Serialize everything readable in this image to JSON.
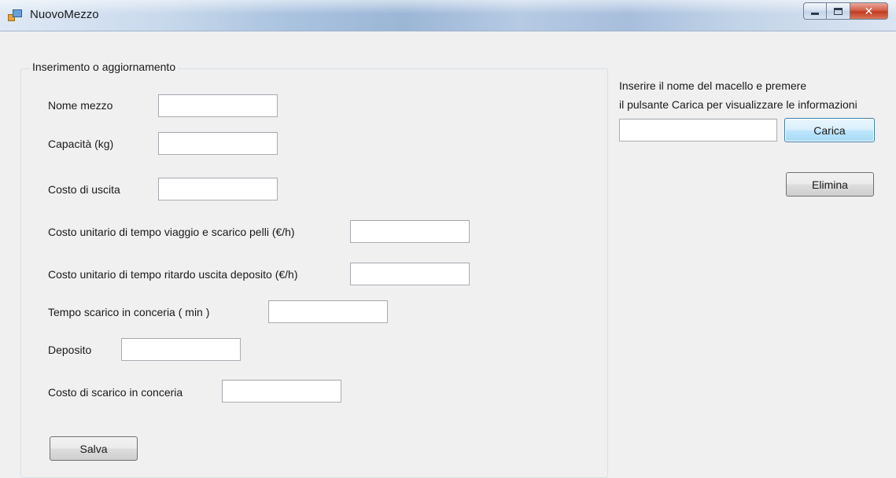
{
  "window": {
    "title": "NuovoMezzo"
  },
  "form": {
    "group_title": "Inserimento o aggiornamento",
    "fields": [
      {
        "label": "Nome mezzo",
        "value": ""
      },
      {
        "label": "Capacità (kg)",
        "value": ""
      },
      {
        "label": "Costo di uscita",
        "value": ""
      },
      {
        "label": "Costo unitario di tempo viaggio e scarico pelli (€/h)",
        "value": ""
      },
      {
        "label": "Costo unitario di tempo ritardo uscita deposito (€/h)",
        "value": ""
      },
      {
        "label": "Tempo scarico in conceria ( min )",
        "value": ""
      },
      {
        "label": "Deposito",
        "value": ""
      },
      {
        "label": "Costo di scarico in conceria",
        "value": ""
      }
    ],
    "save_label": "Salva"
  },
  "lookup": {
    "instruction_line1": "Inserire il nome del macello e premere",
    "instruction_line2": "il pulsante Carica per visualizzare le informazioni",
    "name_value": "",
    "load_label": "Carica",
    "delete_label": "Elimina"
  }
}
